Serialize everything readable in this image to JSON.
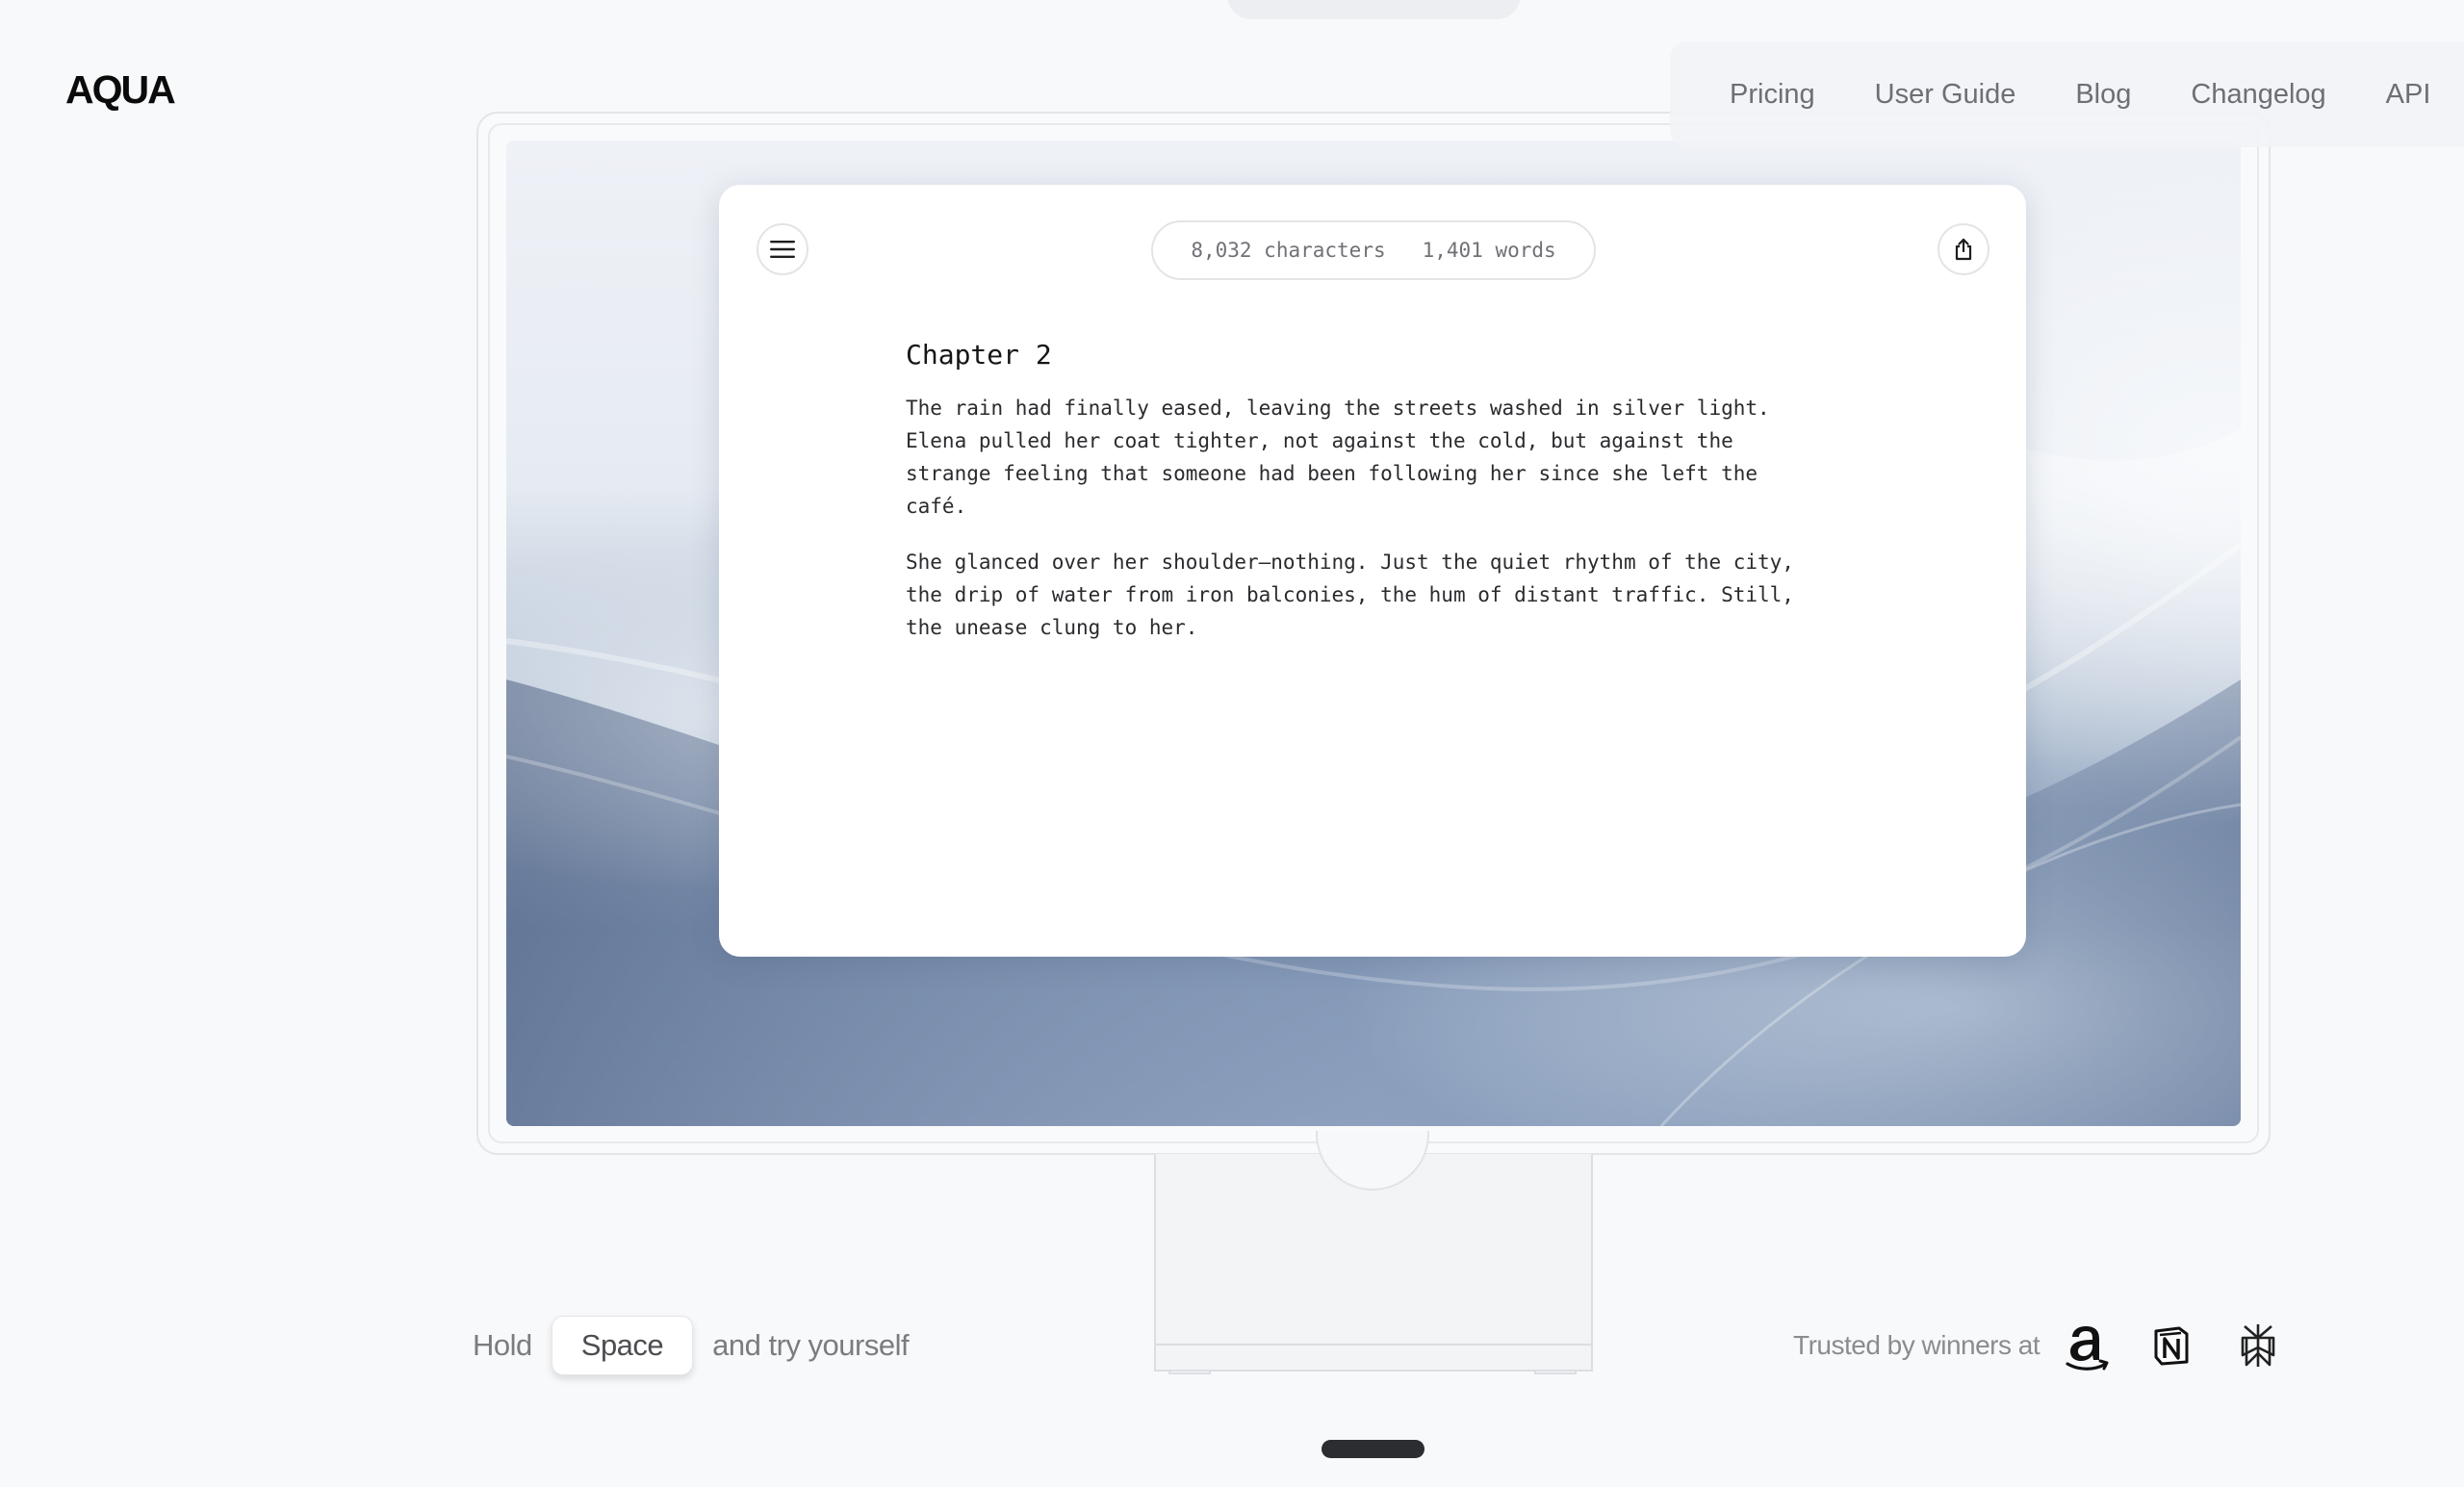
{
  "brand": {
    "logo": "AQUA"
  },
  "nav": {
    "items": [
      {
        "label": "Pricing"
      },
      {
        "label": "User Guide"
      },
      {
        "label": "Blog"
      },
      {
        "label": "Changelog"
      },
      {
        "label": "API"
      }
    ]
  },
  "editor": {
    "menu_icon": "hamburger-menu-icon",
    "share_icon": "share-icon",
    "stats": {
      "characters": "8,032 characters",
      "words": "1,401 words"
    },
    "document": {
      "title": "Chapter 2",
      "paragraphs": [
        "The rain had finally eased, leaving the streets washed in silver light. Elena pulled her coat tighter, not against the cold, but against the strange feeling that someone had been following her since she left the café.",
        "She glanced over her shoulder—nothing. Just the quiet rhythm of the city, the drip of water from iron balconies, the hum of distant traffic. Still, the unease clung to her."
      ]
    }
  },
  "cta": {
    "prefix": "Hold",
    "key": "Space",
    "suffix": "and try yourself"
  },
  "trusted": {
    "label": "Trusted by winners at",
    "brands": [
      "amazon-logo-icon",
      "notion-logo-icon",
      "perplexity-logo-icon"
    ]
  },
  "colors": {
    "background": "#f8f9fb",
    "nav_text": "#6d6f73",
    "home_bar": "#2c2d30",
    "wallpaper_deep": "#7f94b3"
  }
}
